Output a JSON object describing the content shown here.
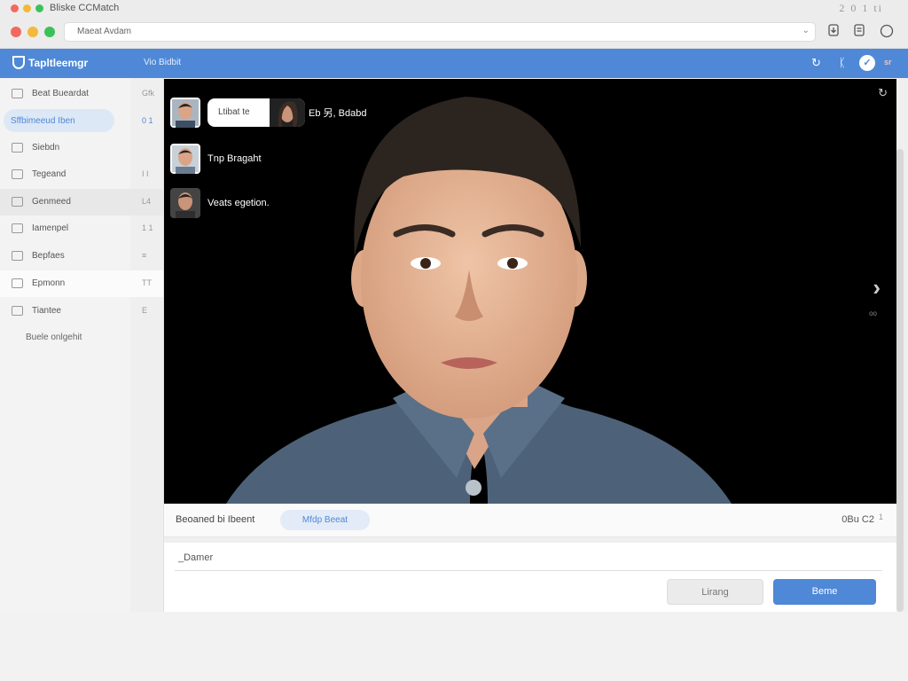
{
  "window": {
    "title": "Bliske CCMatch",
    "top_right": "2 0 1 ti",
    "traffic_colors": [
      "#f26a5f",
      "#f2b93a",
      "#3cc15a"
    ]
  },
  "toolbar": {
    "address_text": "Maeat Avdam",
    "icons": [
      "download-icon",
      "document-icon",
      "circle-icon"
    ]
  },
  "appbar": {
    "brand": "Tapltleemgr",
    "center": "Vio Bidbit",
    "mini_badge": "sr",
    "accent": "#4f88d6"
  },
  "sidebar": {
    "items": [
      {
        "label": "Beat Bueardat",
        "count": "Gfk",
        "state": "normal"
      },
      {
        "label": "Sffbimeeud Iben",
        "count": "0 1",
        "state": "selected"
      },
      {
        "label": "Siebdn",
        "count": "",
        "state": "normal"
      },
      {
        "label": "Tegeand",
        "count": "I I",
        "state": "normal"
      },
      {
        "label": "Genmeed",
        "count": "L4",
        "state": "shaded"
      },
      {
        "label": "Iamenpel",
        "count": "1 1",
        "state": "normal"
      },
      {
        "label": "Bepfaes",
        "count": "≡",
        "state": "normal"
      },
      {
        "label": "Epmonn",
        "count": "TT",
        "state": "white"
      },
      {
        "label": "Tiantee",
        "count": "E",
        "state": "normal"
      }
    ],
    "footer": "Buele onlgehit"
  },
  "video": {
    "participants": [
      {
        "label": "Ltibat te",
        "after": "Eb 另, Bdabd",
        "type": "speech"
      },
      {
        "label": "Tnp Bragaht",
        "type": "plain"
      },
      {
        "label": "Veats egetion.",
        "type": "plain"
      }
    ],
    "next_sub": "oo"
  },
  "caption_bar": {
    "label": "Beoaned bi Ibeent",
    "chip": "Mfdp Beeat",
    "right": "0Bu C2",
    "right_small": "1"
  },
  "composer": {
    "input_value": "_Damer",
    "cancel_label": "Lirang",
    "ok_label": "Beme"
  }
}
